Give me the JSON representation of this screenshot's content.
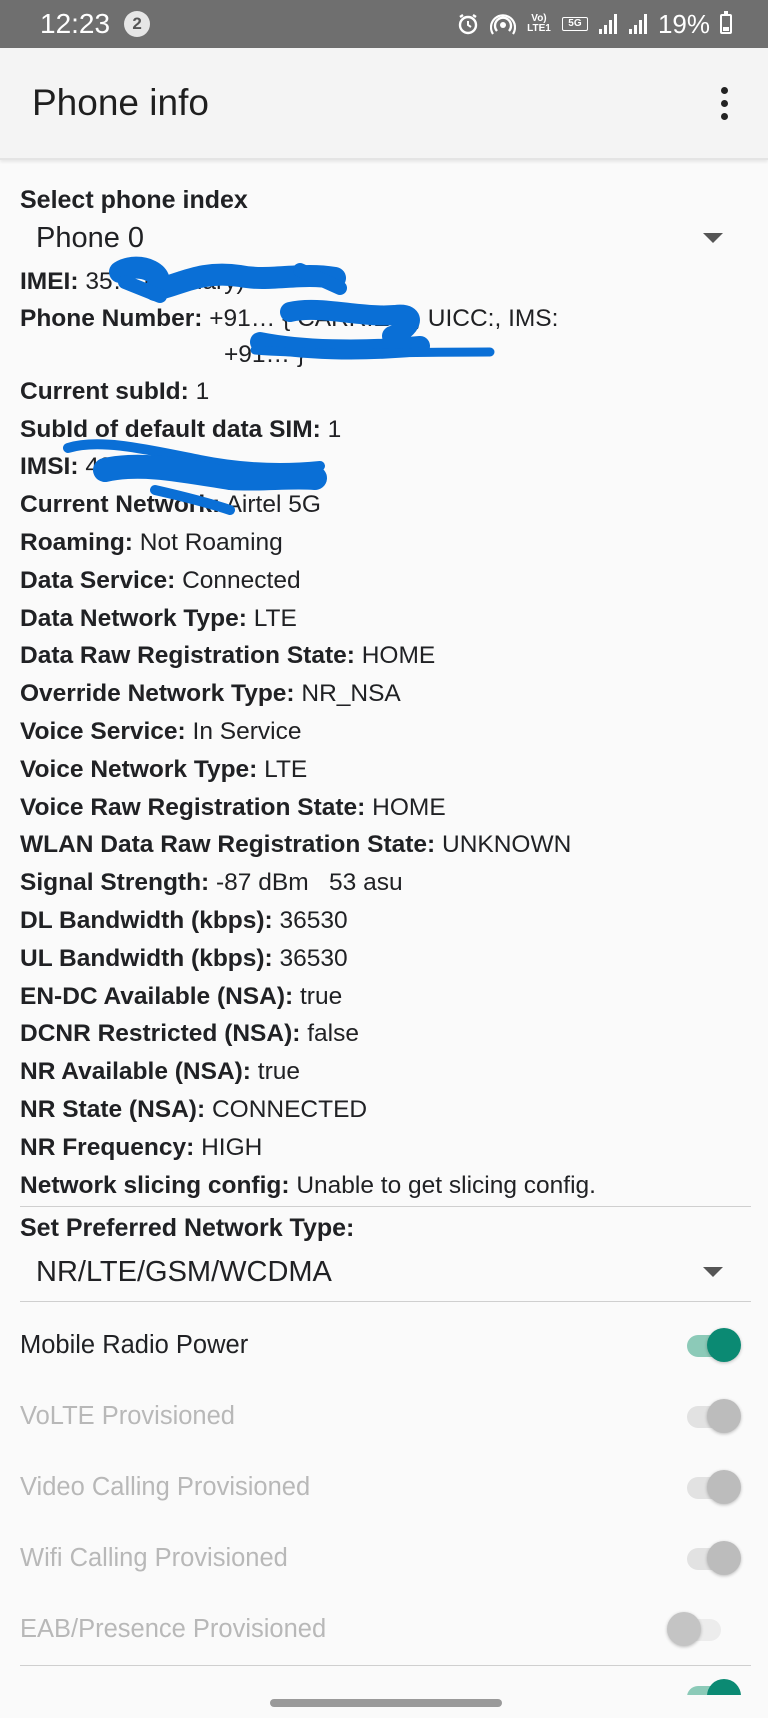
{
  "status_bar": {
    "time": "12:23",
    "notification_count": "2",
    "battery": "19%",
    "icons": [
      "alarm-icon",
      "hotspot-icon",
      "volte-icon",
      "5g-icon",
      "signal-icon",
      "signal-icon",
      "battery-icon"
    ],
    "volte_label": "Vo) LTE1",
    "fiveg_label": "5G"
  },
  "app_bar": {
    "title": "Phone info",
    "menu_icon": "more-vert-icon"
  },
  "phone_index": {
    "label": "Select phone index",
    "selected": "Phone 0"
  },
  "info": [
    {
      "key": "IMEI:",
      "value": "35… (Primary)"
    },
    {
      "key": "Phone Number:",
      "value": "+91… { CARRIER:, UICC:, IMS:",
      "continuation": "+91… }"
    },
    {
      "key": "Current subId:",
      "value": "1"
    },
    {
      "key": "SubId of default data SIM:",
      "value": "1"
    },
    {
      "key": "IMSI:",
      "value": "40…"
    },
    {
      "key": "Current Network:",
      "value": "Airtel 5G"
    },
    {
      "key": "Roaming:",
      "value": "Not Roaming"
    },
    {
      "key": "Data Service:",
      "value": "Connected"
    },
    {
      "key": "Data Network Type:",
      "value": "LTE"
    },
    {
      "key": "Data Raw Registration State:",
      "value": "HOME"
    },
    {
      "key": "Override Network Type:",
      "value": "NR_NSA"
    },
    {
      "key": "Voice Service:",
      "value": "In Service"
    },
    {
      "key": "Voice Network Type:",
      "value": "LTE"
    },
    {
      "key": "Voice Raw Registration State:",
      "value": "HOME"
    },
    {
      "key": "WLAN Data Raw Registration State:",
      "value": "UNKNOWN"
    },
    {
      "key": "Signal Strength:",
      "value": "-87 dBm   53 asu"
    },
    {
      "key": "DL Bandwidth (kbps):",
      "value": "36530"
    },
    {
      "key": "UL Bandwidth (kbps):",
      "value": "36530"
    },
    {
      "key": "EN-DC Available (NSA):",
      "value": "true"
    },
    {
      "key": "DCNR Restricted (NSA):",
      "value": "false"
    },
    {
      "key": "NR Available (NSA):",
      "value": "true"
    },
    {
      "key": "NR State (NSA):",
      "value": "CONNECTED"
    },
    {
      "key": "NR Frequency:",
      "value": "HIGH"
    },
    {
      "key": "Network slicing config:",
      "value": "Unable to get slicing config."
    }
  ],
  "preferred_network": {
    "label": "Set Preferred Network Type:",
    "selected": "NR/LTE/GSM/WCDMA"
  },
  "toggles": [
    {
      "label": "Mobile Radio Power",
      "state": "on",
      "enabled": true
    },
    {
      "label": "VoLTE Provisioned",
      "state": "on",
      "enabled": false
    },
    {
      "label": "Video Calling Provisioned",
      "state": "on",
      "enabled": false
    },
    {
      "label": "Wifi Calling Provisioned",
      "state": "on",
      "enabled": false
    },
    {
      "label": "EAB/Presence Provisioned",
      "state": "off",
      "enabled": false
    }
  ],
  "colors": {
    "accent": "#0b8a73",
    "redaction": "#0a6fd6",
    "status_bar": "#6f6f6f"
  }
}
